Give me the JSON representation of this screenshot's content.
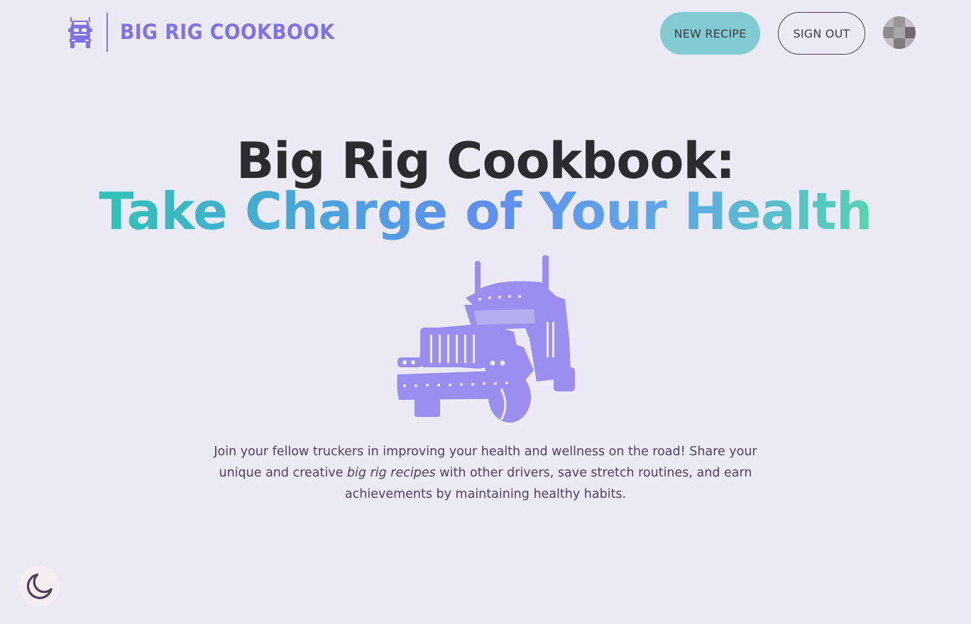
{
  "header": {
    "brand_name": "BIG RIG COOKBOOK",
    "brand_icon": "semi-truck-icon",
    "new_recipe_label": "NEW RECIPE",
    "sign_out_label": "SIGN OUT",
    "avatar_icon": "pixelated-avatar"
  },
  "hero": {
    "title_line1": "Big Rig Cookbook:",
    "title_line2": "Take Charge of Your Health",
    "illustration": "semi-truck-illustration",
    "blurb_part1": "Join your fellow truckers in improving your health and wellness on the road! Share your unique and creative ",
    "blurb_emphasis": "big rig recipes",
    "blurb_part2": " with other drivers, save stretch routines, and earn achievements by maintaining healthy habits."
  },
  "theme_toggle": {
    "icon": "moon-icon"
  },
  "colors": {
    "background": "#ebeaf6",
    "brand_purple": "#8172e6",
    "truck_purple": "#9b8ef0",
    "new_recipe_bg": "#82ccd1",
    "title_dark": "#2c2c30",
    "gradient": [
      "#2fc3b5",
      "#5f8ff1",
      "#55d3b2"
    ],
    "text_body": "#4c4458"
  }
}
